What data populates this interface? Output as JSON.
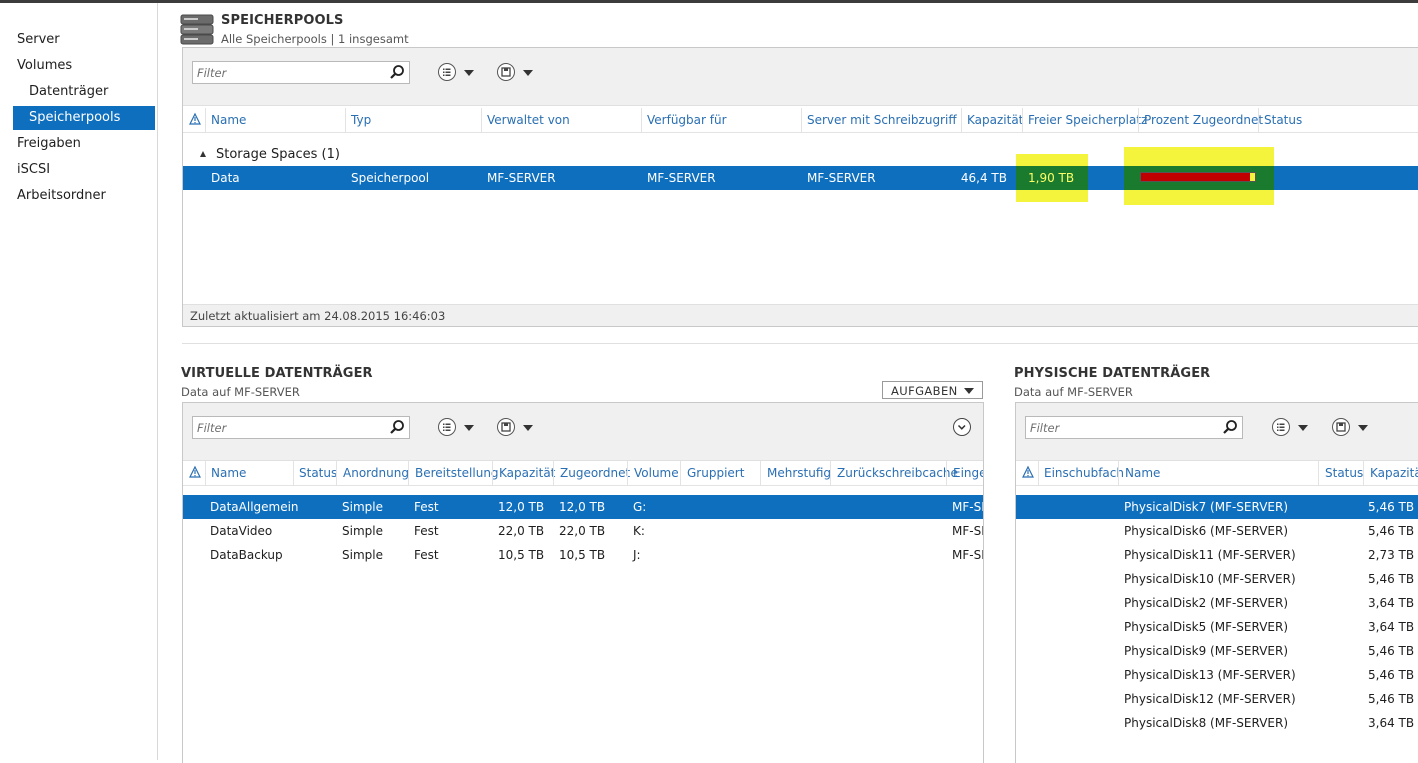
{
  "nav": {
    "items": [
      {
        "label": "Server"
      },
      {
        "label": "Volumes"
      },
      {
        "label": "Datenträger"
      },
      {
        "label": "Speicherpools"
      },
      {
        "label": "Freigaben"
      },
      {
        "label": "iSCSI"
      },
      {
        "label": "Arbeitsordner"
      }
    ],
    "active": "Speicherpools"
  },
  "pools": {
    "title": "SPEICHERPOOLS",
    "subtitle": "Alle Speicherpools | 1 insgesamt",
    "filter_placeholder": "Filter",
    "columns": [
      "Name",
      "Typ",
      "Verwaltet von",
      "Verfügbar für",
      "Server mit Schreibzugriff",
      "Kapazität",
      "Freier Speicherplatz",
      "Prozent Zugeordnet",
      "Status"
    ],
    "group_label": "Storage Spaces (1)",
    "row": {
      "name": "Data",
      "type": "Speicherpool",
      "managed_by": "MF-SERVER",
      "available_for": "MF-SERVER",
      "write_server": "MF-SERVER",
      "capacity": "46,4 TB",
      "free_space": "1,90 TB",
      "percent_allocated": 96
    },
    "last_updated": "Zuletzt aktualisiert am 24.08.2015 16:46:03"
  },
  "virtual": {
    "title": "VIRTUELLE DATENTRÄGER",
    "subtitle": "Data auf MF-SERVER",
    "tasks_label": "AUFGABEN",
    "filter_placeholder": "Filter",
    "columns": [
      "Name",
      "Status",
      "Anordnung",
      "Bereitstellung",
      "Kapazität",
      "Zugeordnet",
      "Volume",
      "Gruppiert",
      "Mehrstufig",
      "Zurückschreibcache",
      "Einge"
    ],
    "rows": [
      {
        "name": "DataAllgemein",
        "layout": "Simple",
        "provisioning": "Fest",
        "capacity": "12,0 TB",
        "allocated": "12,0 TB",
        "volume": "G:",
        "enclosure": "MF-SE"
      },
      {
        "name": "DataVideo",
        "layout": "Simple",
        "provisioning": "Fest",
        "capacity": "22,0 TB",
        "allocated": "22,0 TB",
        "volume": "K:",
        "enclosure": "MF-SE"
      },
      {
        "name": "DataBackup",
        "layout": "Simple",
        "provisioning": "Fest",
        "capacity": "10,5 TB",
        "allocated": "10,5 TB",
        "volume": "J:",
        "enclosure": "MF-SE"
      }
    ]
  },
  "physical": {
    "title": "PHYSISCHE DATENTRÄGER",
    "subtitle": "Data auf MF-SERVER",
    "filter_placeholder": "Filter",
    "columns": [
      "Einschubfach",
      "Name",
      "Status",
      "Kapazität"
    ],
    "rows": [
      {
        "name": "PhysicalDisk7 (MF-SERVER)",
        "capacity": "5,46 TB"
      },
      {
        "name": "PhysicalDisk6 (MF-SERVER)",
        "capacity": "5,46 TB"
      },
      {
        "name": "PhysicalDisk11 (MF-SERVER)",
        "capacity": "2,73 TB"
      },
      {
        "name": "PhysicalDisk10 (MF-SERVER)",
        "capacity": "5,46 TB"
      },
      {
        "name": "PhysicalDisk2 (MF-SERVER)",
        "capacity": "3,64 TB"
      },
      {
        "name": "PhysicalDisk5 (MF-SERVER)",
        "capacity": "3,64 TB"
      },
      {
        "name": "PhysicalDisk9 (MF-SERVER)",
        "capacity": "5,46 TB"
      },
      {
        "name": "PhysicalDisk13 (MF-SERVER)",
        "capacity": "5,46 TB"
      },
      {
        "name": "PhysicalDisk12 (MF-SERVER)",
        "capacity": "5,46 TB"
      },
      {
        "name": "PhysicalDisk8 (MF-SERVER)",
        "capacity": "3,64 TB"
      }
    ]
  },
  "colors": {
    "selection": "#0e6fbe",
    "highlight": "#f4f43c",
    "bar_fill": "#c00000",
    "header_text": "#2a6fb3"
  }
}
